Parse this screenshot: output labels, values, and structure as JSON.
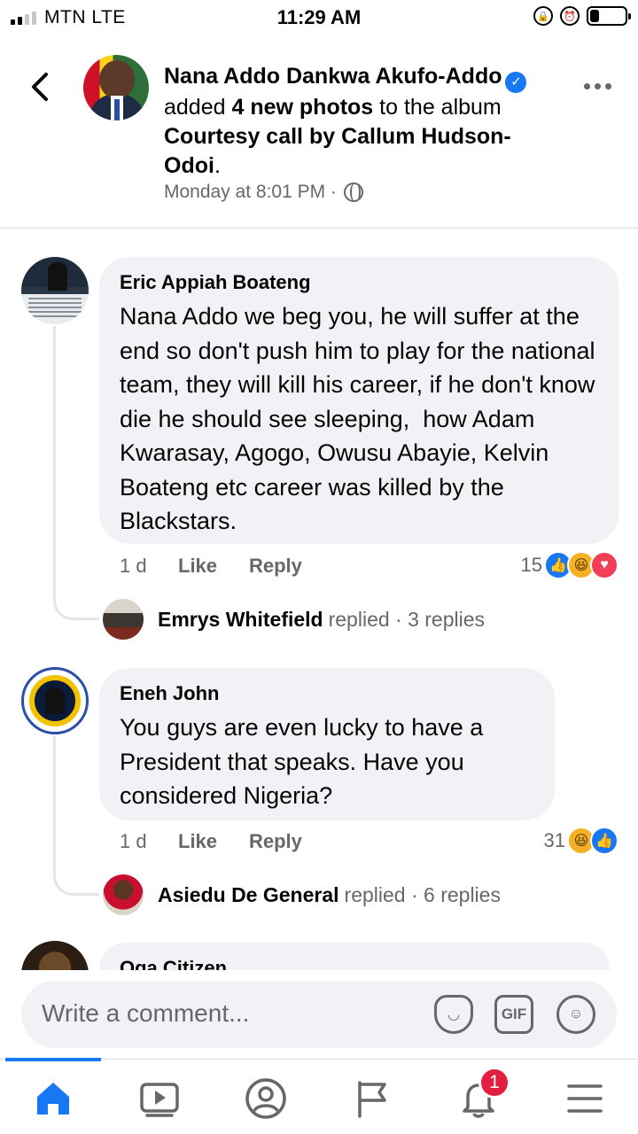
{
  "status_bar": {
    "carrier": "MTN  LTE",
    "time": "11:29 AM"
  },
  "post": {
    "author": "Nana Addo Dankwa Akufo-Addo",
    "added_text": "added",
    "photo_count": "4 new photos",
    "to_album_text": "to the album",
    "album_name": "Courtesy call by Callum Hudson-Odoi",
    "period": ".",
    "timestamp": "Monday at 8:01 PM ·"
  },
  "comments": [
    {
      "author": "Eric Appiah Boateng",
      "text": "Nana Addo we beg you, he will suffer at the end so don't push him to play for the national team, they will kill his career, if he don't know die he should see sleeping,  how Adam Kwarasay, Agogo, Owusu Abayie, Kelvin Boateng etc career was killed by the Blackstars.",
      "age": "1 d",
      "like_label": "Like",
      "reply_label": "Reply",
      "reaction_count": "15",
      "reactions": [
        "like-icon",
        "haha-icon",
        "love-icon"
      ],
      "reply_preview": {
        "name": "Emrys Whitefield",
        "action": "replied",
        "count": "· 3 replies"
      }
    },
    {
      "author": "Eneh John",
      "text": "You guys are even lucky to have a President that speaks. Have you considered Nigeria?",
      "age": "1 d",
      "like_label": "Like",
      "reply_label": "Reply",
      "reaction_count": "31",
      "reactions": [
        "haha-icon",
        "like-icon"
      ],
      "reply_preview": {
        "name": "Asiedu De General",
        "action": "replied",
        "count": "· 6 replies"
      }
    },
    {
      "author": "Oga Citizen"
    }
  ],
  "composer": {
    "placeholder": "Write a comment...",
    "gif_label": "GIF"
  },
  "bottom_nav": {
    "items": [
      "home-icon",
      "watch-icon",
      "profile-icon",
      "pages-icon",
      "notifications-icon",
      "menu-icon"
    ],
    "notification_badge": "1",
    "active": "home-icon"
  },
  "colors": {
    "accent": "#1877f2",
    "bubble": "#f0f2f5",
    "secondary_text": "#65676b",
    "badge": "#e41e3f"
  }
}
